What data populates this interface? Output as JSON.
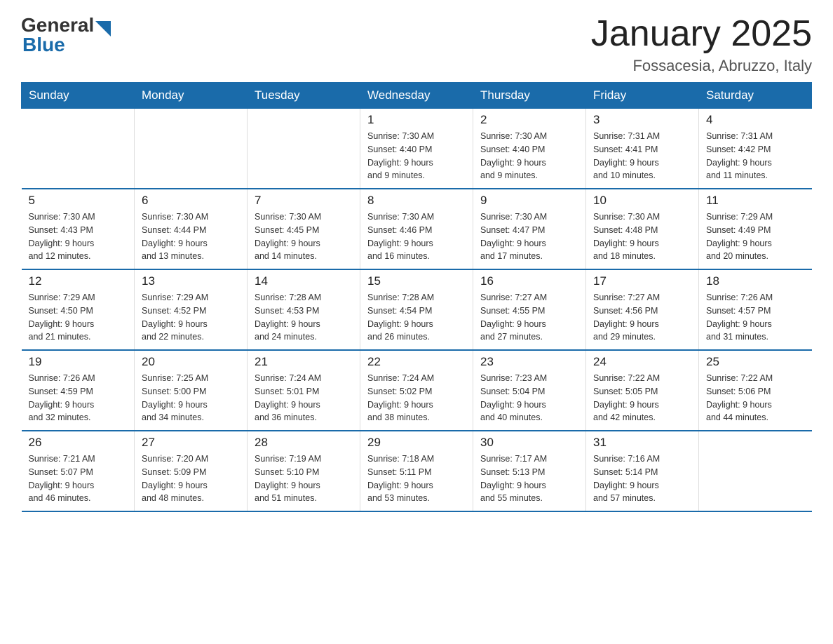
{
  "header": {
    "logo_general": "General",
    "logo_blue": "Blue",
    "title": "January 2025",
    "subtitle": "Fossacesia, Abruzzo, Italy"
  },
  "days_of_week": [
    "Sunday",
    "Monday",
    "Tuesday",
    "Wednesday",
    "Thursday",
    "Friday",
    "Saturday"
  ],
  "weeks": [
    [
      {
        "day": "",
        "info": ""
      },
      {
        "day": "",
        "info": ""
      },
      {
        "day": "",
        "info": ""
      },
      {
        "day": "1",
        "info": "Sunrise: 7:30 AM\nSunset: 4:40 PM\nDaylight: 9 hours\nand 9 minutes."
      },
      {
        "day": "2",
        "info": "Sunrise: 7:30 AM\nSunset: 4:40 PM\nDaylight: 9 hours\nand 9 minutes."
      },
      {
        "day": "3",
        "info": "Sunrise: 7:31 AM\nSunset: 4:41 PM\nDaylight: 9 hours\nand 10 minutes."
      },
      {
        "day": "4",
        "info": "Sunrise: 7:31 AM\nSunset: 4:42 PM\nDaylight: 9 hours\nand 11 minutes."
      }
    ],
    [
      {
        "day": "5",
        "info": "Sunrise: 7:30 AM\nSunset: 4:43 PM\nDaylight: 9 hours\nand 12 minutes."
      },
      {
        "day": "6",
        "info": "Sunrise: 7:30 AM\nSunset: 4:44 PM\nDaylight: 9 hours\nand 13 minutes."
      },
      {
        "day": "7",
        "info": "Sunrise: 7:30 AM\nSunset: 4:45 PM\nDaylight: 9 hours\nand 14 minutes."
      },
      {
        "day": "8",
        "info": "Sunrise: 7:30 AM\nSunset: 4:46 PM\nDaylight: 9 hours\nand 16 minutes."
      },
      {
        "day": "9",
        "info": "Sunrise: 7:30 AM\nSunset: 4:47 PM\nDaylight: 9 hours\nand 17 minutes."
      },
      {
        "day": "10",
        "info": "Sunrise: 7:30 AM\nSunset: 4:48 PM\nDaylight: 9 hours\nand 18 minutes."
      },
      {
        "day": "11",
        "info": "Sunrise: 7:29 AM\nSunset: 4:49 PM\nDaylight: 9 hours\nand 20 minutes."
      }
    ],
    [
      {
        "day": "12",
        "info": "Sunrise: 7:29 AM\nSunset: 4:50 PM\nDaylight: 9 hours\nand 21 minutes."
      },
      {
        "day": "13",
        "info": "Sunrise: 7:29 AM\nSunset: 4:52 PM\nDaylight: 9 hours\nand 22 minutes."
      },
      {
        "day": "14",
        "info": "Sunrise: 7:28 AM\nSunset: 4:53 PM\nDaylight: 9 hours\nand 24 minutes."
      },
      {
        "day": "15",
        "info": "Sunrise: 7:28 AM\nSunset: 4:54 PM\nDaylight: 9 hours\nand 26 minutes."
      },
      {
        "day": "16",
        "info": "Sunrise: 7:27 AM\nSunset: 4:55 PM\nDaylight: 9 hours\nand 27 minutes."
      },
      {
        "day": "17",
        "info": "Sunrise: 7:27 AM\nSunset: 4:56 PM\nDaylight: 9 hours\nand 29 minutes."
      },
      {
        "day": "18",
        "info": "Sunrise: 7:26 AM\nSunset: 4:57 PM\nDaylight: 9 hours\nand 31 minutes."
      }
    ],
    [
      {
        "day": "19",
        "info": "Sunrise: 7:26 AM\nSunset: 4:59 PM\nDaylight: 9 hours\nand 32 minutes."
      },
      {
        "day": "20",
        "info": "Sunrise: 7:25 AM\nSunset: 5:00 PM\nDaylight: 9 hours\nand 34 minutes."
      },
      {
        "day": "21",
        "info": "Sunrise: 7:24 AM\nSunset: 5:01 PM\nDaylight: 9 hours\nand 36 minutes."
      },
      {
        "day": "22",
        "info": "Sunrise: 7:24 AM\nSunset: 5:02 PM\nDaylight: 9 hours\nand 38 minutes."
      },
      {
        "day": "23",
        "info": "Sunrise: 7:23 AM\nSunset: 5:04 PM\nDaylight: 9 hours\nand 40 minutes."
      },
      {
        "day": "24",
        "info": "Sunrise: 7:22 AM\nSunset: 5:05 PM\nDaylight: 9 hours\nand 42 minutes."
      },
      {
        "day": "25",
        "info": "Sunrise: 7:22 AM\nSunset: 5:06 PM\nDaylight: 9 hours\nand 44 minutes."
      }
    ],
    [
      {
        "day": "26",
        "info": "Sunrise: 7:21 AM\nSunset: 5:07 PM\nDaylight: 9 hours\nand 46 minutes."
      },
      {
        "day": "27",
        "info": "Sunrise: 7:20 AM\nSunset: 5:09 PM\nDaylight: 9 hours\nand 48 minutes."
      },
      {
        "day": "28",
        "info": "Sunrise: 7:19 AM\nSunset: 5:10 PM\nDaylight: 9 hours\nand 51 minutes."
      },
      {
        "day": "29",
        "info": "Sunrise: 7:18 AM\nSunset: 5:11 PM\nDaylight: 9 hours\nand 53 minutes."
      },
      {
        "day": "30",
        "info": "Sunrise: 7:17 AM\nSunset: 5:13 PM\nDaylight: 9 hours\nand 55 minutes."
      },
      {
        "day": "31",
        "info": "Sunrise: 7:16 AM\nSunset: 5:14 PM\nDaylight: 9 hours\nand 57 minutes."
      },
      {
        "day": "",
        "info": ""
      }
    ]
  ]
}
